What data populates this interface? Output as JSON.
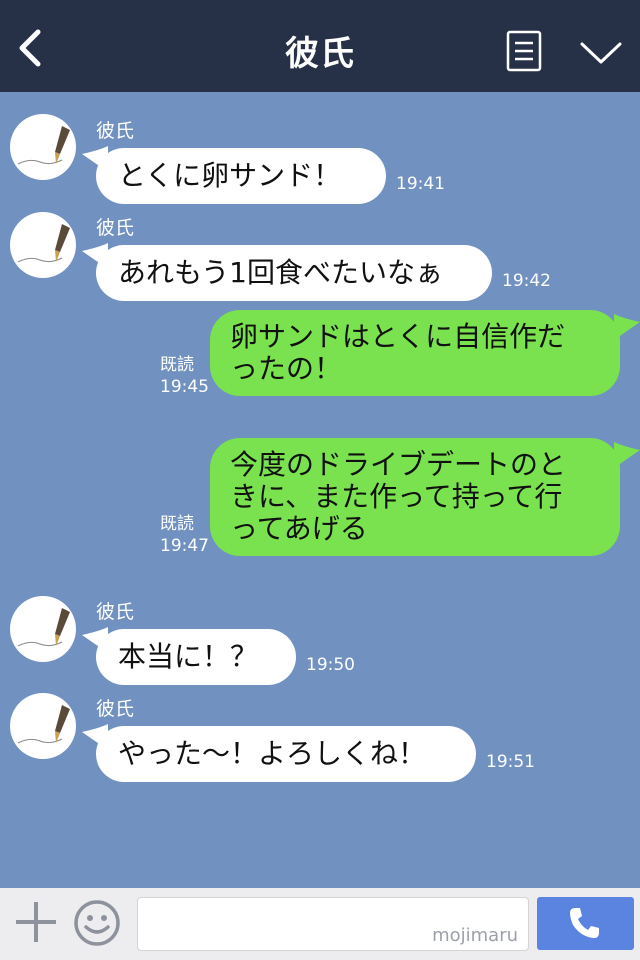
{
  "header": {
    "title": "彼氏"
  },
  "messages": [
    {
      "side": "in",
      "sender": "彼氏",
      "text": "とくに卵サンド！",
      "time": "19:41"
    },
    {
      "side": "in",
      "sender": "彼氏",
      "text": "あれもう1回食べたいなぁ",
      "time": "19:42"
    },
    {
      "side": "out",
      "status": "既読",
      "text_lines": [
        "卵サンドはとくに自信作だ",
        "ったの！"
      ],
      "time": "19:45"
    },
    {
      "side": "out",
      "status": "既読",
      "text_lines": [
        "今度のドライブデートのと",
        "きに、また作って持って行",
        "ってあげる"
      ],
      "time": "19:47"
    },
    {
      "side": "in",
      "sender": "彼氏",
      "text": "本当に！？",
      "time": "19:50"
    },
    {
      "side": "in",
      "sender": "彼氏",
      "text": "やった〜！よろしくね！",
      "time": "19:51"
    }
  ],
  "input": {
    "watermark": "mojimaru"
  },
  "colors": {
    "header_bg": "#263047",
    "chat_bg": "#7192c0",
    "outgoing_bubble": "#7ae14f",
    "incoming_bubble": "#ffffff",
    "call_button": "#5a84e0"
  },
  "icons": {
    "back": "chevron-left-icon",
    "menu": "menu-list-icon",
    "collapse": "chevron-down-icon",
    "add": "plus-icon",
    "sticker": "smiley-icon",
    "call": "phone-icon"
  }
}
